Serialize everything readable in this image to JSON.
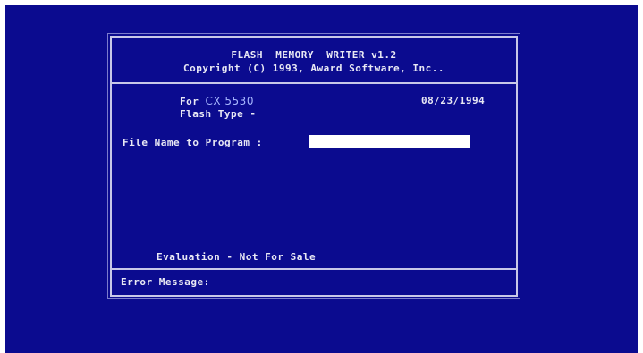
{
  "header": {
    "title": "FLASH  MEMORY  WRITER v1.2",
    "copyright": "Copyright (C) 1993, Award Software, Inc.."
  },
  "info": {
    "for_label": "For",
    "model": "CX 5530",
    "date": "08/23/1994",
    "flash_type_label": "Flash Type -"
  },
  "program": {
    "label": "File Name to Program :",
    "value": ""
  },
  "notice": "Evaluation - Not For Sale",
  "footer": {
    "error_label": "Error Message:"
  },
  "colors": {
    "background": "#0b0b8f",
    "text": "#e8e8f4",
    "model_text": "#a8b8ff",
    "input_bg": "#ffffff"
  }
}
